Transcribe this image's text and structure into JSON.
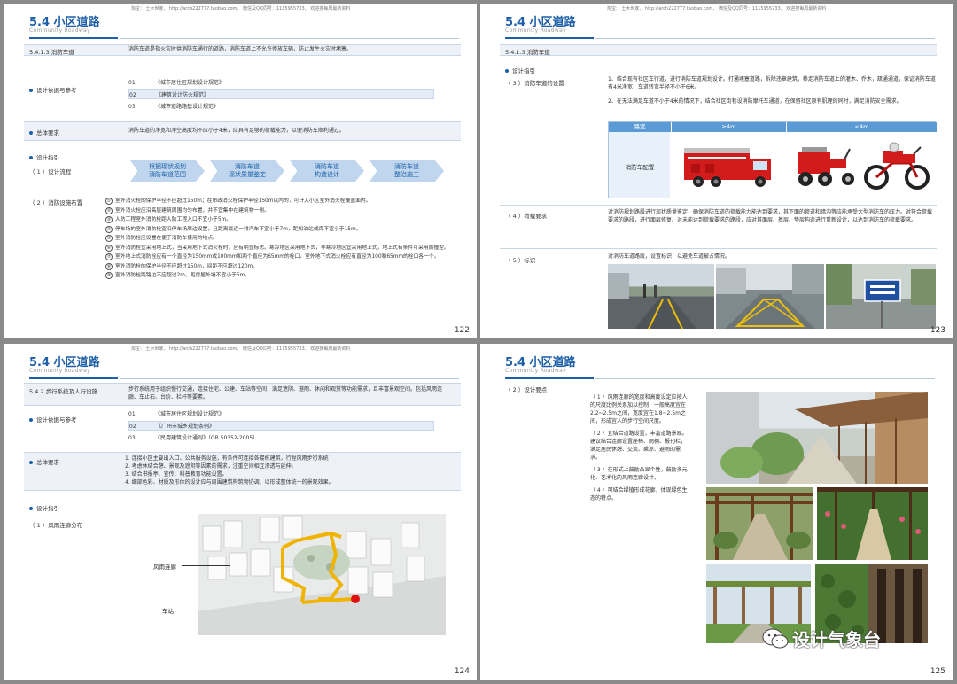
{
  "watermark": "淘宝：  土木世家、  http://arch222777.taobao.com、  微信及QQ同号：1115955733、  欢迎搜每周最新资料",
  "section_title": "5.4 小区道路",
  "section_subtitle": "Community  Roadway",
  "p122": {
    "page_number": "122",
    "heading": "5.4.1.3 消防车道",
    "intro": "消防车道是指火灾时供消防车通行的道路，消防车道上不允许停放车辆，防止发生火灾时堵塞。",
    "basis_label": "设计依据与参考",
    "refs": [
      {
        "n": "01",
        "t": "《城市居住区规划设计规范》"
      },
      {
        "n": "02",
        "t": "《建筑设计防火规范》"
      },
      {
        "n": "03",
        "t": "《城市道路路基设计规范》"
      }
    ],
    "general_label": "总体要求",
    "general_text": "消防车道的净宽和净空高度均不应小于4米，应具有足够的荷载能力，以便消防车顺利通过。",
    "guide_label": "设计指引",
    "flow_label": "（ 1 ）设计流程",
    "flow": [
      "根据现状规划\n消防车道范围",
      "消防车道\n现状质量鉴定",
      "消防车道\n构造设计",
      "消防车道\n整治施工"
    ],
    "layout_label": "（ 2 ）消防设施布置",
    "items": [
      {
        "n": "①",
        "t": "室外消火栓的保护半径不应超过150m；在市政消火栓保护半径150m以内的，可计入小区室外消火栓覆盖面内。"
      },
      {
        "n": "②",
        "t": "室外消火栓应沿高层建筑周围均匀布置，并不宜集中在建筑物一侧。"
      },
      {
        "n": "③",
        "t": "人防工程室外消防栓距人防工程入口不宜小于5m。"
      },
      {
        "n": "④",
        "t": "停车场的室外消防栓宜沿停车场周边设置，且距离最近一排汽车不宜小于7m，距加油站或库不宜小于15m。"
      },
      {
        "n": "⑤",
        "t": "室外消防栓应设置在便于消防车使用的地点。"
      },
      {
        "n": "⑥",
        "t": "室外消防栓宜采用地上式，当采用地下式消火栓时，应有明显标志。寒冷地区采用地下式，非寒冷地区宜采用地上式，地上式有条件可采用防撞型。"
      },
      {
        "n": "⑦",
        "t": "室外地上式消防栓应有一个直径为150mm或100mm和两个直径为65mm的栓口。室外地下式消火栓应有直径为100和65mm的栓口各一个。"
      },
      {
        "n": "⑧",
        "t": "室外消防栓的保护半径不应超过150m，间距不应超过120m。"
      },
      {
        "n": "⑨",
        "t": "室外消防栓距路边不应超过2m，距房屋外墙不宜小于5m。"
      }
    ]
  },
  "p123": {
    "page_number": "123",
    "heading": "5.4.1.3 消防车道",
    "guide_label": "设计指引",
    "s3_label": "（ 3 ）消防车道的设置",
    "s3_text1": "1、结合现有社区车行道，进行消防车道规划设计。打通堵塞道路，拆除违章建筑，移走消防车道上的灌木、乔木，疏通通道，保证消防车道有4米净宽，车道转弯半径不小于6米。",
    "s3_text2": "2、在无法满足车道不小于4米的情况下，结合社区街巷设消防摩托车通道，在保留社区原有肌理的同时，满足消防安全需求。",
    "table_headers": [
      "路宽",
      "≥4m",
      "<4m"
    ],
    "table_row_label": "消防车配置",
    "s4_label": "（ 4 ）荷载要求",
    "s4_text": "对消防规划路段进行现状质量鉴定，确保消防车道的荷载能力能达到要求，其下面的管道和暗沟等应能承受大型消防车的压力。对符合荷载要求的路段，进行面层修复。对未能达到荷载要求的路段，应对其面层、基层、垫层构造进行重新设计，以达到消防车的荷载要求。",
    "s5_label": "（ 5 ）标识",
    "s5_text": "对消防车道路段，设置标识，以避免车道被占情况。"
  },
  "p124": {
    "page_number": "124",
    "heading": "5.4.2 步行系统及人行设施",
    "intro": "步行系统用于组织慢行交通，连接住宅、公建、车站等空间，满足遮阴、避雨、休闲和观赏等功能需求，且丰富景观空间。包括风雨连廊、车止石、台阶、栏杆等要素。",
    "basis_label": "设计依据与参考",
    "refs": [
      {
        "n": "01",
        "t": "《城市居住区规划设计规范》"
      },
      {
        "n": "02",
        "t": "《广州市城乡规划条例》"
      },
      {
        "n": "03",
        "t": "《民用建筑设计通则》（GB 50352-2005）"
      }
    ],
    "general_label": "总体要求",
    "general_items": [
      "1.  连接小区主要出入口、公共服务设施，有条件可连接各楼栋建筑，行程风雨步行系统",
      "2.  考虑休结合憩、景观及遮阴等因素的需求，注重空间相互渗透与延伸。",
      "3.  结合书报亭、宣传、科普教育功能设置。",
      "4.  细部色彩、材质及形体的设计应与周围建筑构筑物协调，以形成整体统一的景观效果。"
    ],
    "guide_label": "设计指引",
    "dist_label": "（ 1 ）风雨连廊分布",
    "map_label_corridor": "风雨连廊",
    "map_label_station": "车站"
  },
  "p125": {
    "page_number": "125",
    "points_label": "（ 2 ）设计要点",
    "points": [
      "（ 1 ）风雨连廊的宽度和高度设定应按人的尺度比例关系加以控制，一般高度宜在2.2~2.5m之间，宽度宜在1.8~2.5m之间，形成宜人的步行空间尺度。",
      "（ 2 ）宜结合道路设置，丰富道路景观。建议结合连廊设置座椅、雨棚、报刊栏，满足居民休憩、交流、乘凉、避雨的需求。",
      "（ 3 ）在形式上鼓励凸显个性，鼓励多元化、艺术化的风雨连廊设计。",
      "（ 4 ）可结合绿植形成花廊，体现绿色生态的特点。"
    ],
    "brand": "设计气象台"
  },
  "colors": {
    "title_blue": "#1c5fa8",
    "table_head": "#5b9bd5",
    "flow_fill": "#bfd6ee",
    "corridor_orange": "#f0b400",
    "station_red": "#e01010"
  }
}
